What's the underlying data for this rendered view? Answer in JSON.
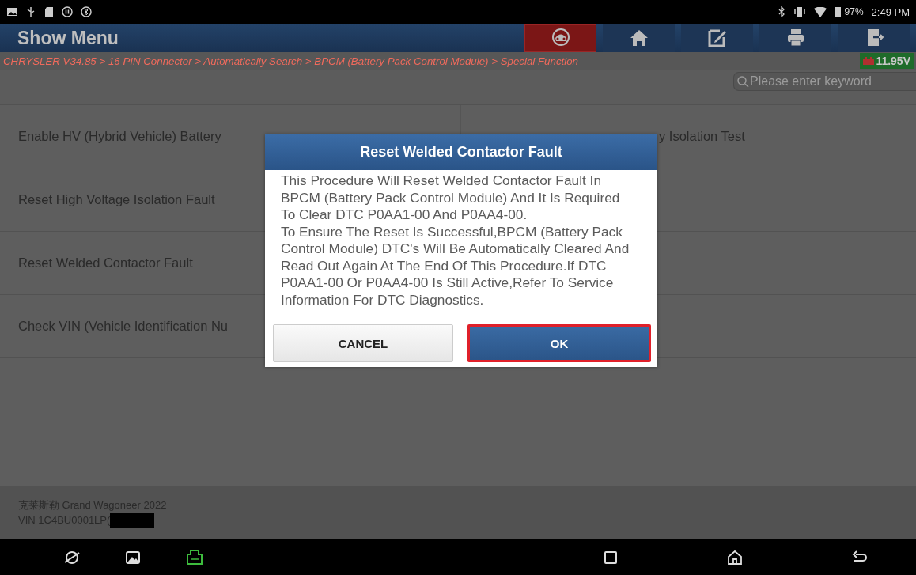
{
  "status_bar": {
    "battery": "97%",
    "time": "2:49 PM"
  },
  "header": {
    "title": "Show Menu",
    "buttons": [
      {
        "kind": "vehicle",
        "selected": true
      },
      {
        "kind": "home",
        "selected": false
      },
      {
        "kind": "edit",
        "selected": false
      },
      {
        "kind": "print",
        "selected": false
      },
      {
        "kind": "exit",
        "selected": false
      }
    ]
  },
  "breadcrumb": "CHRYSLER V34.85 > 16 PIN Connector > Automatically Search > BPCM (Battery Pack Control Module) > Special Function",
  "voltage": "11.95V",
  "search": {
    "placeholder": "Please enter keyword"
  },
  "menu": {
    "rows": [
      {
        "cells": [
          "Enable HV (Hybrid Vehicle) Battery",
          "y Isolation Test"
        ]
      },
      {
        "cells": [
          "Reset High Voltage Isolation Fault"
        ]
      },
      {
        "cells": [
          "Reset Welded Contactor Fault"
        ]
      },
      {
        "cells": [
          "Check VIN (Vehicle Identification Nu"
        ]
      }
    ]
  },
  "vehicle": {
    "name": "克莱斯勒 Grand Wagoneer 2022",
    "vin": "VIN 1C4BU0001LP("
  },
  "dialog": {
    "title": "Reset Welded Contactor Fault",
    "paragraphs": [
      "This Procedure Will Reset Welded Contactor Fault In BPCM (Battery Pack Control Module) And It Is Required To Clear DTC P0AA1-00 And P0AA4-00.",
      "To Ensure The Reset Is Successful,BPCM (Battery Pack Control Module) DTC's Will Be Automatically Cleared And Read Out Again At The End Of This Procedure.If DTC P0AA1-00 Or P0AA4-00 Is Still Active,Refer To Service Information For DTC Diagnostics."
    ],
    "buttons": [
      {
        "label": "CANCEL",
        "selected": false
      },
      {
        "label": "OK",
        "selected": true
      }
    ]
  }
}
